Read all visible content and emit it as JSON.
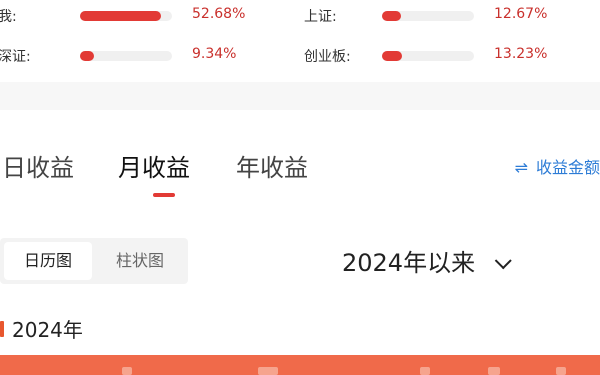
{
  "comparison": [
    {
      "label": "我:",
      "value_text": "52.68%",
      "fraction": 0.5268
    },
    {
      "label": "上证:",
      "value_text": "12.67%",
      "fraction": 0.1267
    },
    {
      "label": "深证:",
      "value_text": "9.34%",
      "fraction": 0.0934
    },
    {
      "label": "创业板:",
      "value_text": "13.23%",
      "fraction": 0.1323
    }
  ],
  "tabs": [
    {
      "label": "日收益",
      "active": false
    },
    {
      "label": "月收益",
      "active": true
    },
    {
      "label": "年收益",
      "active": false
    }
  ],
  "amount_toggle": {
    "icon": "swap-arrows-icon",
    "label": "收益金额"
  },
  "view_switch": [
    {
      "label": "日历图",
      "active": true
    },
    {
      "label": "柱状图",
      "active": false
    }
  ],
  "range": {
    "label": "2024年以来",
    "icon": "chevron-down-icon"
  },
  "year_heading": "2024年",
  "colors": {
    "accent": "#e23a35",
    "value_red": "#c9302c",
    "link_blue": "#2d7cd6",
    "strip": "#f06a4a"
  }
}
